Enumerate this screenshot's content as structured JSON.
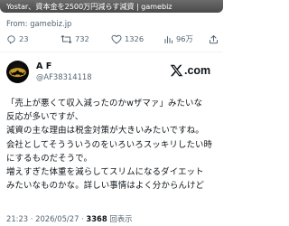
{
  "quoted_card": {
    "caption": "Yostar、資本金を2500万円減らす減資 | gamebiz",
    "from": "From: gamebiz.jp"
  },
  "actions": {
    "replies": "23",
    "reposts": "732",
    "likes": "1326",
    "views": "96万"
  },
  "author": {
    "name": "A F",
    "handle": "@AF38314118"
  },
  "brand": {
    "x_suffix": ".com"
  },
  "tweet": {
    "lines": [
      "「売上が悪くて収入減ったのかwザマァ」みたいな",
      "反応が多いですが、",
      "減資の主な理由は税金対策が大きいみたいですね。",
      "会社としてそうういうのをいろいろスッキリしたい時",
      "にするものだそうで。",
      "増えすぎた体重を減らしてスリムになるダイエット",
      "みたいなものかな。詳しい事情はよく分からんけど"
    ]
  },
  "meta": {
    "time_date": "21:23 · 2026/05/27 · ",
    "views_count": "3368",
    "views_label": " 回表示"
  },
  "colors": {
    "text": "#0f1419",
    "muted": "#536471",
    "divider": "#eff3f4"
  }
}
